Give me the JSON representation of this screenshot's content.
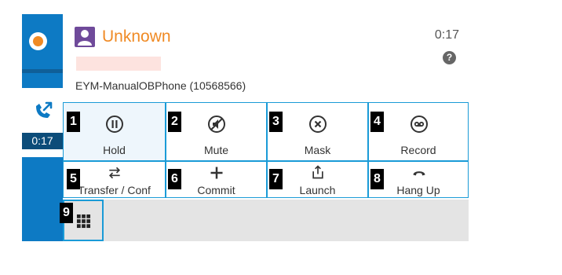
{
  "contact": {
    "name": "Unknown",
    "timer": "0:17",
    "phone_label": "EYM-ManualOBPhone (10568566)"
  },
  "sidebar": {
    "call_timer": "0:17"
  },
  "help": {
    "glyph": "?"
  },
  "buttons": [
    {
      "badge": "1",
      "label": "Hold",
      "icon": "pause-icon"
    },
    {
      "badge": "2",
      "label": "Mute",
      "icon": "mute-icon"
    },
    {
      "badge": "3",
      "label": "Mask",
      "icon": "mask-icon"
    },
    {
      "badge": "4",
      "label": "Record",
      "icon": "record-icon"
    },
    {
      "badge": "5",
      "label": "Transfer / Conf",
      "icon": "transfer-icon"
    },
    {
      "badge": "6",
      "label": "Commit",
      "icon": "plus-icon"
    },
    {
      "badge": "7",
      "label": "Launch",
      "icon": "launch-icon"
    },
    {
      "badge": "8",
      "label": "Hang Up",
      "icon": "hangup-icon"
    },
    {
      "badge": "9",
      "label": "",
      "icon": "dialpad-icon"
    }
  ],
  "colors": {
    "accent": "#0d7ac4",
    "name": "#f08a24",
    "border": "#1a9bd7"
  }
}
